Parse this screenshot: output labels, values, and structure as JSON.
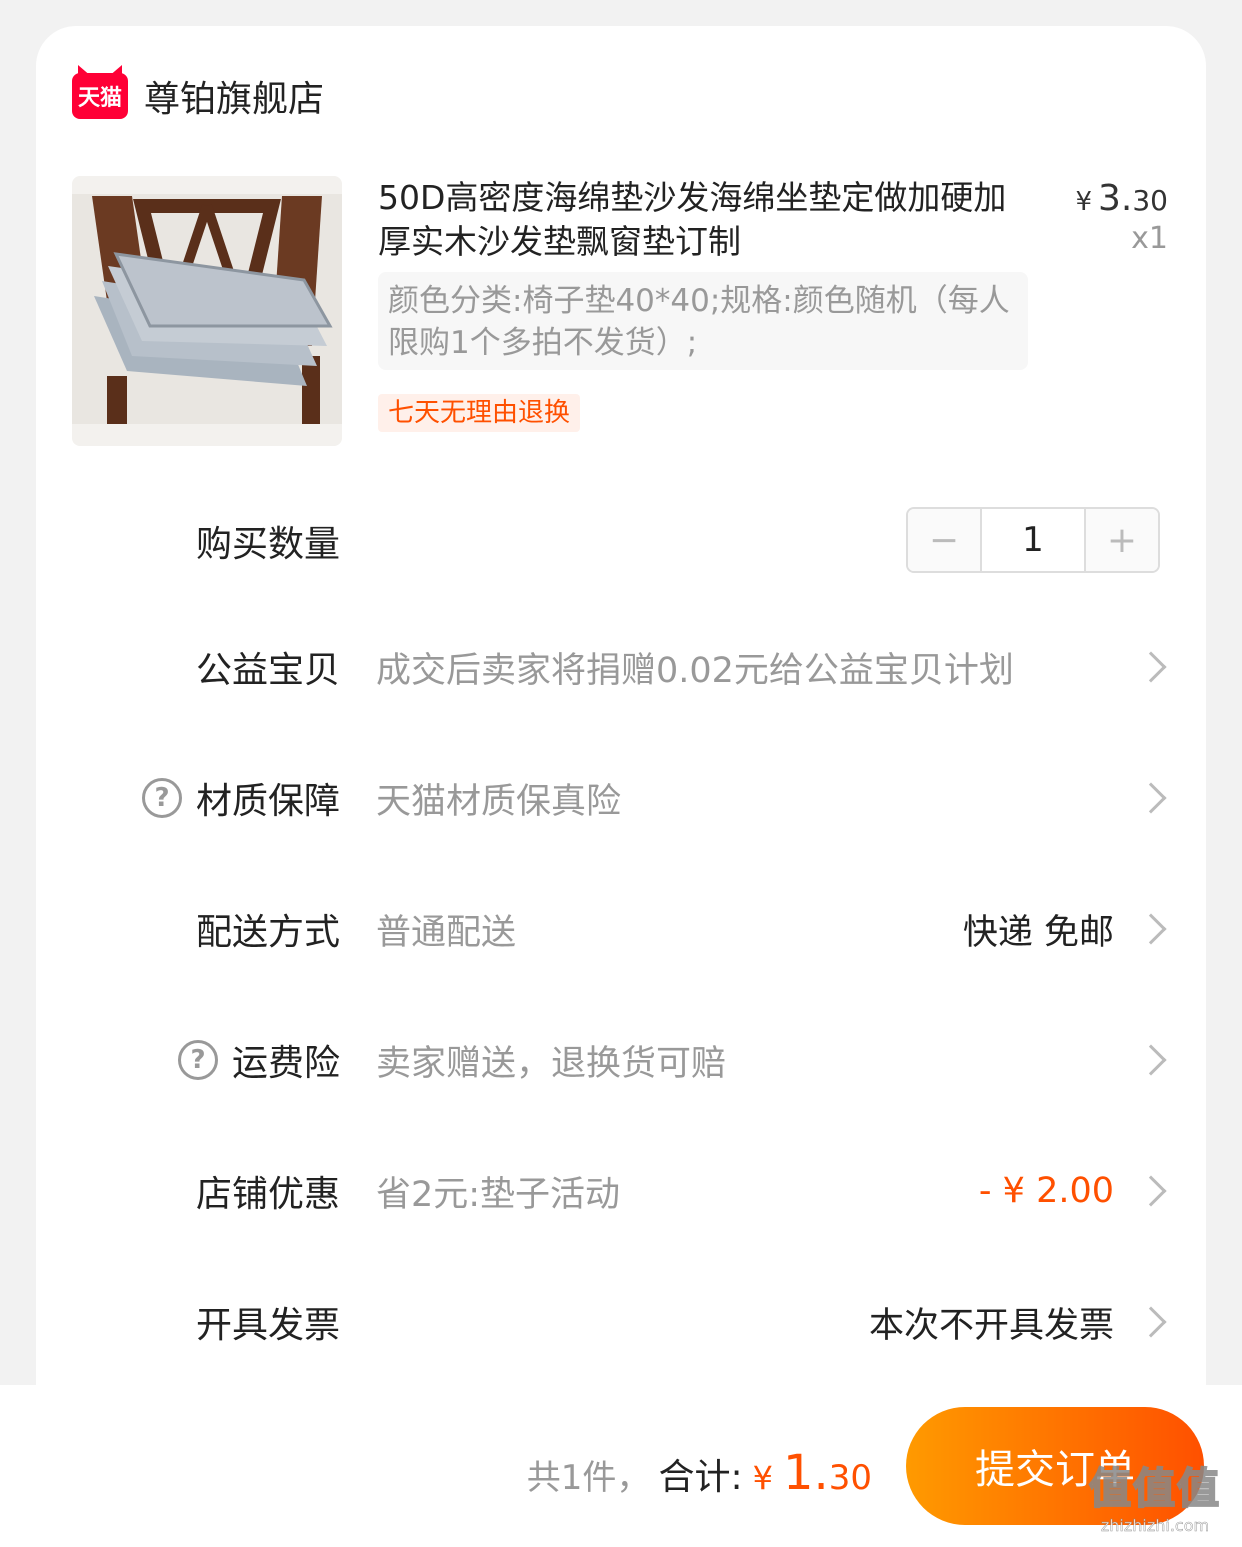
{
  "shop": {
    "logo_text": "天猫",
    "name": "尊铂旗舰店"
  },
  "product": {
    "title": "50D高密度海绵垫沙发海绵坐垫定做加硬加厚实木沙发垫飘窗垫订制",
    "price_symbol": "¥",
    "price_int": "3.",
    "price_cents": "30",
    "quantity_label": "x1",
    "sku": "颜色分类:椅子垫40*40;规格:颜色随机（每人限购1个多拍不发货）;",
    "return_badge": "七天无理由退换"
  },
  "rows": {
    "quantity": {
      "label": "购买数量",
      "value": "1",
      "minus": "−",
      "plus": "+"
    },
    "charity": {
      "label": "公益宝贝",
      "value": "成交后卖家将捐赠0.02元给公益宝贝计划"
    },
    "material": {
      "label": "材质保障",
      "value": "天猫材质保真险",
      "help": "?"
    },
    "delivery": {
      "label": "配送方式",
      "value": "普通配送",
      "right": "快递 免邮"
    },
    "freight_insurance": {
      "label": "运费险",
      "value": "卖家赠送，退换货可赔",
      "help": "?"
    },
    "shop_discount": {
      "label": "店铺优惠",
      "value": "省2元:垫子活动",
      "right": "- ¥ 2.00"
    },
    "invoice": {
      "label": "开具发票",
      "right": "本次不开具发票"
    }
  },
  "footer": {
    "count": "共1件，",
    "total_label": "合计:",
    "yen": "¥",
    "amount_int": "1.",
    "amount_cents": "30",
    "submit_label": "提交订单"
  },
  "watermark": {
    "main": "值值值",
    "sub": "zhizhizhi.com"
  },
  "colors": {
    "accent": "#ff5000",
    "tmall_red": "#ff0036"
  }
}
